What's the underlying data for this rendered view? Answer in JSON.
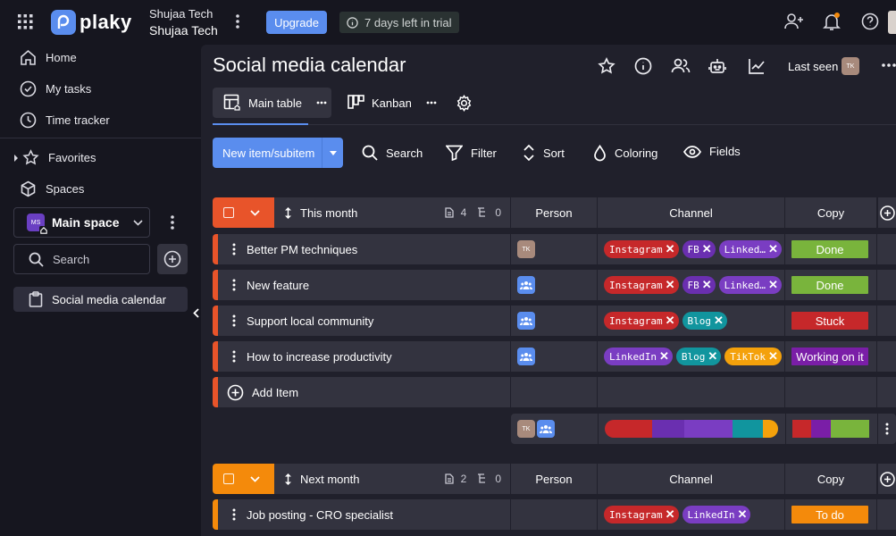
{
  "app": {
    "brand": "plaky"
  },
  "workspace": {
    "line1": "Shujaa Tech",
    "line2": "Shujaa Tech"
  },
  "topbar": {
    "upgrade_label": "Upgrade",
    "trial_text": "7 days left in trial"
  },
  "sidebar": {
    "items": [
      {
        "label": "Home",
        "icon": "home-icon"
      },
      {
        "label": "My tasks",
        "icon": "check-circle-icon"
      },
      {
        "label": "Time tracker",
        "icon": "clock-icon"
      }
    ],
    "favorites_label": "Favorites",
    "spaces_label": "Spaces",
    "space": {
      "badge": "MS",
      "label": "Main space"
    },
    "search_placeholder": "Search",
    "board_label": "Social media calendar"
  },
  "board": {
    "title": "Social media calendar",
    "last_seen_label": "Last seen",
    "last_seen_avatar": "TK",
    "tabs": [
      {
        "label": "Main table",
        "active": true
      },
      {
        "label": "Kanban",
        "active": false
      }
    ]
  },
  "toolbar": {
    "new_item_label": "New item/subitem",
    "search_label": "Search",
    "filter_label": "Filter",
    "sort_label": "Sort",
    "coloring_label": "Coloring",
    "fields_label": "Fields"
  },
  "columns": {
    "person": "Person",
    "channel": "Channel",
    "copy": "Copy"
  },
  "colors": {
    "accent": "#5a8dee",
    "group1": "#e8542a",
    "group2": "#f48a0b",
    "instagram": "#c6282a",
    "fb": "#6a2fb0",
    "linkedin": "#7a3dc2",
    "blog": "#11959e",
    "tiktok": "#f4a10b",
    "done": "#79b43c",
    "stuck": "#c6282a",
    "working": "#7a1ea7",
    "todo": "#f48a0b"
  },
  "groups": [
    {
      "name": "This month",
      "items_count": "4",
      "subitems_count": "0",
      "rows": [
        {
          "name": "Better PM techniques",
          "person": "TK",
          "channels": [
            "Instagram",
            "FB",
            "Linked…"
          ],
          "copy": "Done"
        },
        {
          "name": "New feature",
          "person": "team",
          "channels": [
            "Instagram",
            "FB",
            "Linked…"
          ],
          "copy": "Done"
        },
        {
          "name": "Support local community",
          "person": "team",
          "channels": [
            "Instagram",
            "Blog"
          ],
          "copy": "Stuck"
        },
        {
          "name": "How to increase productivity",
          "person": "team",
          "channels": [
            "LinkedIn",
            "Blog",
            "TikTok"
          ],
          "copy": "Working on it"
        }
      ],
      "add_item_label": "Add Item"
    },
    {
      "name": "Next month",
      "items_count": "2",
      "subitems_count": "0",
      "rows": [
        {
          "name": "Job posting - CRO specialist",
          "person": "",
          "channels": [
            "Instagram",
            "LinkedIn"
          ],
          "copy": "To do"
        }
      ]
    }
  ]
}
